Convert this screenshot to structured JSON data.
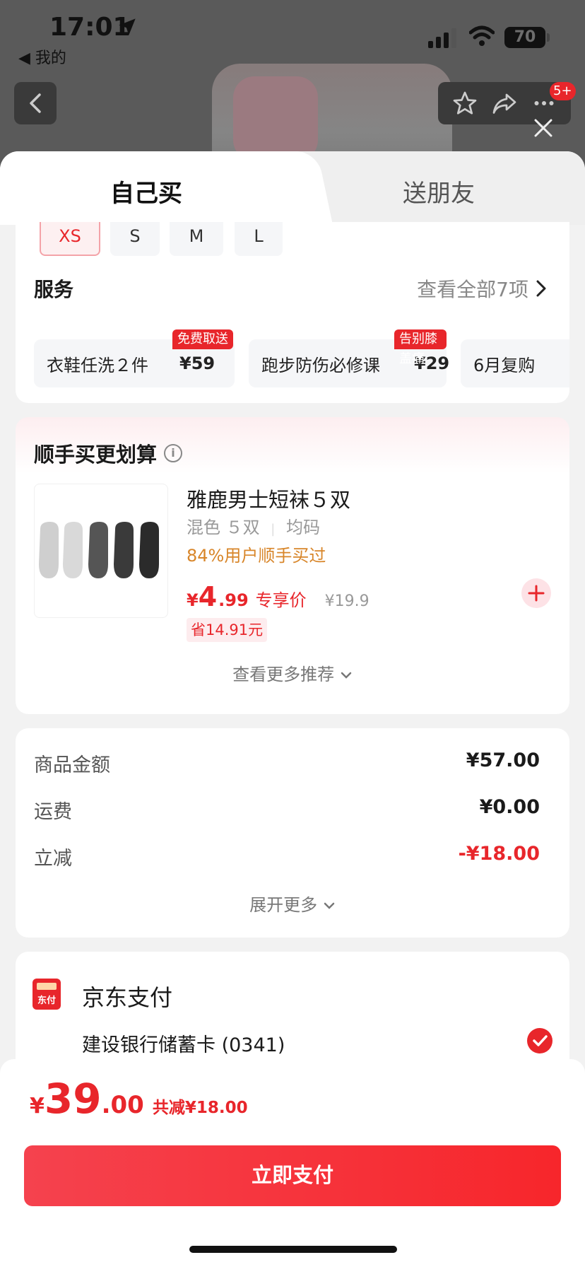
{
  "status_bar": {
    "time": "17:01",
    "back_app": "◀ 我的",
    "battery": "70"
  },
  "nav": {
    "cart_badge": "5+"
  },
  "tabs": {
    "self_buy": "自己买",
    "gift": "送朋友"
  },
  "sizes": {
    "xs": "XS",
    "s": "S",
    "m": "M",
    "l": "L",
    "selected": "XS"
  },
  "service": {
    "title": "服务",
    "view_all": "查看全部7项",
    "items": [
      {
        "name": "衣鞋任洗２件",
        "price": "¥59",
        "tag": "免费取送"
      },
      {
        "name": "跑步防伤必修课",
        "price": "¥29",
        "tag": "告别膝盖痛"
      },
      {
        "name": "6月复购",
        "price": "",
        "tag": ""
      }
    ]
  },
  "addon": {
    "title": "顺手买更划算",
    "product_name": "雅鹿男士短袜５双",
    "spec_color": "混色 ５双",
    "spec_size": "均码",
    "bought_rate": "84%用户顺手买过",
    "price_currency": "¥",
    "price_int": "4",
    "price_dec": ".99",
    "price_label": "专享价",
    "orig_price": "¥19.9",
    "save": "省14.91元",
    "more": "查看更多推荐"
  },
  "amounts": {
    "goods_label": "商品金额",
    "goods_value": "¥57.00",
    "shipping_label": "运费",
    "shipping_value": "¥0.00",
    "discount_label": "立减",
    "discount_value": "-¥18.00",
    "expand": "展开更多"
  },
  "payment": {
    "method": "京东支付",
    "icon_text": "东付",
    "card": "建设银行储蓄卡 (0341)"
  },
  "bottom": {
    "currency": "¥",
    "total_int": "39",
    "total_dec": ".00",
    "reduce": "共减¥18.00",
    "pay_button": "立即支付"
  },
  "colors": {
    "accent": "#e8262b",
    "bought": "#d8862a"
  }
}
